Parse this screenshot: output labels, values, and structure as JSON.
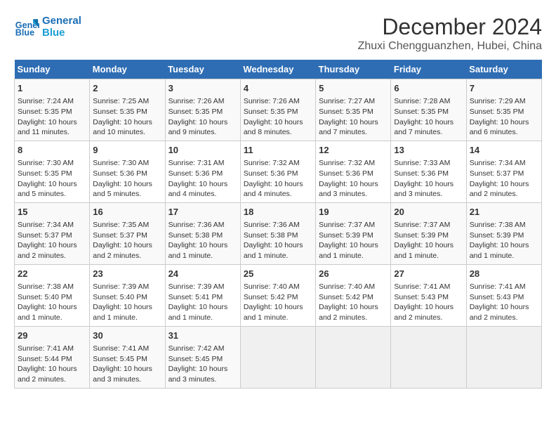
{
  "header": {
    "logo_line1": "General",
    "logo_line2": "Blue",
    "title": "December 2024",
    "subtitle": "Zhuxi Chengguanzhen, Hubei, China"
  },
  "weekdays": [
    "Sunday",
    "Monday",
    "Tuesday",
    "Wednesday",
    "Thursday",
    "Friday",
    "Saturday"
  ],
  "weeks": [
    [
      {
        "day": "1",
        "info": "Sunrise: 7:24 AM\nSunset: 5:35 PM\nDaylight: 10 hours and 11 minutes."
      },
      {
        "day": "2",
        "info": "Sunrise: 7:25 AM\nSunset: 5:35 PM\nDaylight: 10 hours and 10 minutes."
      },
      {
        "day": "3",
        "info": "Sunrise: 7:26 AM\nSunset: 5:35 PM\nDaylight: 10 hours and 9 minutes."
      },
      {
        "day": "4",
        "info": "Sunrise: 7:26 AM\nSunset: 5:35 PM\nDaylight: 10 hours and 8 minutes."
      },
      {
        "day": "5",
        "info": "Sunrise: 7:27 AM\nSunset: 5:35 PM\nDaylight: 10 hours and 7 minutes."
      },
      {
        "day": "6",
        "info": "Sunrise: 7:28 AM\nSunset: 5:35 PM\nDaylight: 10 hours and 7 minutes."
      },
      {
        "day": "7",
        "info": "Sunrise: 7:29 AM\nSunset: 5:35 PM\nDaylight: 10 hours and 6 minutes."
      }
    ],
    [
      {
        "day": "8",
        "info": "Sunrise: 7:30 AM\nSunset: 5:35 PM\nDaylight: 10 hours and 5 minutes."
      },
      {
        "day": "9",
        "info": "Sunrise: 7:30 AM\nSunset: 5:36 PM\nDaylight: 10 hours and 5 minutes."
      },
      {
        "day": "10",
        "info": "Sunrise: 7:31 AM\nSunset: 5:36 PM\nDaylight: 10 hours and 4 minutes."
      },
      {
        "day": "11",
        "info": "Sunrise: 7:32 AM\nSunset: 5:36 PM\nDaylight: 10 hours and 4 minutes."
      },
      {
        "day": "12",
        "info": "Sunrise: 7:32 AM\nSunset: 5:36 PM\nDaylight: 10 hours and 3 minutes."
      },
      {
        "day": "13",
        "info": "Sunrise: 7:33 AM\nSunset: 5:36 PM\nDaylight: 10 hours and 3 minutes."
      },
      {
        "day": "14",
        "info": "Sunrise: 7:34 AM\nSunset: 5:37 PM\nDaylight: 10 hours and 2 minutes."
      }
    ],
    [
      {
        "day": "15",
        "info": "Sunrise: 7:34 AM\nSunset: 5:37 PM\nDaylight: 10 hours and 2 minutes."
      },
      {
        "day": "16",
        "info": "Sunrise: 7:35 AM\nSunset: 5:37 PM\nDaylight: 10 hours and 2 minutes."
      },
      {
        "day": "17",
        "info": "Sunrise: 7:36 AM\nSunset: 5:38 PM\nDaylight: 10 hours and 1 minute."
      },
      {
        "day": "18",
        "info": "Sunrise: 7:36 AM\nSunset: 5:38 PM\nDaylight: 10 hours and 1 minute."
      },
      {
        "day": "19",
        "info": "Sunrise: 7:37 AM\nSunset: 5:39 PM\nDaylight: 10 hours and 1 minute."
      },
      {
        "day": "20",
        "info": "Sunrise: 7:37 AM\nSunset: 5:39 PM\nDaylight: 10 hours and 1 minute."
      },
      {
        "day": "21",
        "info": "Sunrise: 7:38 AM\nSunset: 5:39 PM\nDaylight: 10 hours and 1 minute."
      }
    ],
    [
      {
        "day": "22",
        "info": "Sunrise: 7:38 AM\nSunset: 5:40 PM\nDaylight: 10 hours and 1 minute."
      },
      {
        "day": "23",
        "info": "Sunrise: 7:39 AM\nSunset: 5:40 PM\nDaylight: 10 hours and 1 minute."
      },
      {
        "day": "24",
        "info": "Sunrise: 7:39 AM\nSunset: 5:41 PM\nDaylight: 10 hours and 1 minute."
      },
      {
        "day": "25",
        "info": "Sunrise: 7:40 AM\nSunset: 5:42 PM\nDaylight: 10 hours and 1 minute."
      },
      {
        "day": "26",
        "info": "Sunrise: 7:40 AM\nSunset: 5:42 PM\nDaylight: 10 hours and 2 minutes."
      },
      {
        "day": "27",
        "info": "Sunrise: 7:41 AM\nSunset: 5:43 PM\nDaylight: 10 hours and 2 minutes."
      },
      {
        "day": "28",
        "info": "Sunrise: 7:41 AM\nSunset: 5:43 PM\nDaylight: 10 hours and 2 minutes."
      }
    ],
    [
      {
        "day": "29",
        "info": "Sunrise: 7:41 AM\nSunset: 5:44 PM\nDaylight: 10 hours and 2 minutes."
      },
      {
        "day": "30",
        "info": "Sunrise: 7:41 AM\nSunset: 5:45 PM\nDaylight: 10 hours and 3 minutes."
      },
      {
        "day": "31",
        "info": "Sunrise: 7:42 AM\nSunset: 5:45 PM\nDaylight: 10 hours and 3 minutes."
      },
      {
        "day": "",
        "info": ""
      },
      {
        "day": "",
        "info": ""
      },
      {
        "day": "",
        "info": ""
      },
      {
        "day": "",
        "info": ""
      }
    ]
  ]
}
